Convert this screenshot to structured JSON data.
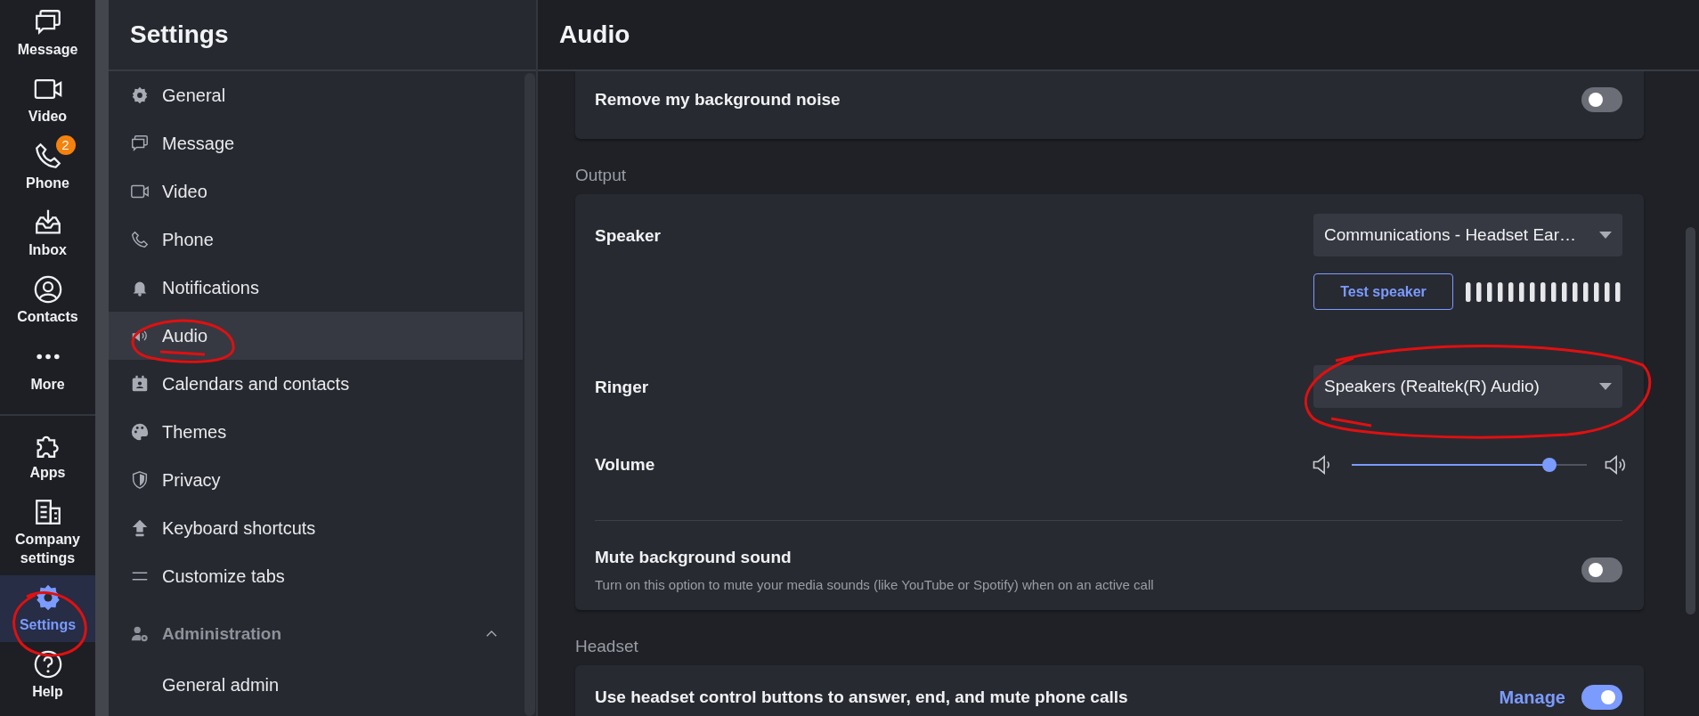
{
  "rail": {
    "top": [
      {
        "label": "Message",
        "selected": false
      },
      {
        "label": "Video",
        "selected": false
      },
      {
        "label": "Phone",
        "selected": false,
        "badge": "2"
      },
      {
        "label": "Inbox",
        "selected": false
      },
      {
        "label": "Contacts",
        "selected": false
      },
      {
        "label": "More",
        "selected": false
      }
    ],
    "bottom": [
      {
        "label": "Apps",
        "selected": false
      },
      {
        "label": "Company settings",
        "selected": false
      },
      {
        "label": "Settings",
        "selected": true
      },
      {
        "label": "Help",
        "selected": false
      }
    ]
  },
  "settings_nav": {
    "title": "Settings",
    "items": [
      {
        "label": "General",
        "selected": false
      },
      {
        "label": "Message",
        "selected": false
      },
      {
        "label": "Video",
        "selected": false
      },
      {
        "label": "Phone",
        "selected": false
      },
      {
        "label": "Notifications",
        "selected": false
      },
      {
        "label": "Audio",
        "selected": true
      },
      {
        "label": "Calendars and contacts",
        "selected": false
      },
      {
        "label": "Themes",
        "selected": false
      },
      {
        "label": "Privacy",
        "selected": false
      },
      {
        "label": "Keyboard shortcuts",
        "selected": false
      },
      {
        "label": "Customize tabs",
        "selected": false
      }
    ],
    "section": {
      "label": "Administration",
      "expanded": true,
      "items": [
        {
          "label": "General admin",
          "selected": false
        }
      ]
    }
  },
  "page": {
    "title": "Audio",
    "blocks": [
      {
        "kind": "card",
        "rows": [
          {
            "kind": "toggle",
            "label": "Remove my background noise",
            "on": false
          }
        ]
      },
      {
        "kind": "heading",
        "label": "Output"
      },
      {
        "kind": "card",
        "rows": [
          {
            "kind": "select",
            "label": "Speaker",
            "value": "Communications - Headset Ear…",
            "test_button": "Test speaker"
          },
          {
            "kind": "select",
            "label": "Ringer",
            "value": "Speakers (Realtek(R) Audio)"
          },
          {
            "kind": "slider",
            "label": "Volume",
            "level": 0.84
          },
          {
            "kind": "divider"
          },
          {
            "kind": "toggle",
            "label": "Mute background sound",
            "description": "Turn on this option to mute your media sounds (like YouTube or Spotify) when on an active call",
            "on": false
          }
        ]
      },
      {
        "kind": "heading",
        "label": "Headset"
      },
      {
        "kind": "card",
        "rows": [
          {
            "kind": "toggle",
            "label": "Use headset control buttons to answer, end, and mute phone calls",
            "link": "Manage",
            "on": true
          }
        ]
      }
    ]
  }
}
